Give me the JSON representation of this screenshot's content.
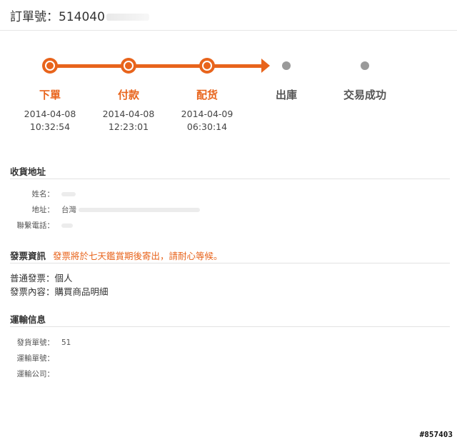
{
  "header": {
    "order_label": "訂單號：",
    "order_number": "514040"
  },
  "progress": {
    "accent_color": "#e8641c",
    "steps": [
      {
        "label": "下單",
        "date": "2014-04-08",
        "time": "10:32:54",
        "state": "done"
      },
      {
        "label": "付款",
        "date": "2014-04-08",
        "time": "12:23:01",
        "state": "done"
      },
      {
        "label": "配货",
        "date": "2014-04-09",
        "time": "06:30:14",
        "state": "done"
      },
      {
        "label": "出庫",
        "state": "pending"
      },
      {
        "label": "交易成功",
        "state": "pending"
      }
    ]
  },
  "address": {
    "title": "收貨地址",
    "name_label": "姓名：",
    "address_label": "地址：",
    "address_value": "台灣",
    "phone_label": "聯繫電話："
  },
  "invoice": {
    "title": "發票資訊",
    "note": "發票將於七天鑑賞期後寄出，請耐心等候。",
    "type_line": "普通發票：個人",
    "content_line": "發票內容：購買商品明細"
  },
  "shipping": {
    "title": "運輸信息",
    "ship_no_label": "發貨單號：",
    "ship_no_value": "51",
    "tracking_label": "運輸單號：",
    "company_label": "運輸公司："
  },
  "watermark": "#857403"
}
